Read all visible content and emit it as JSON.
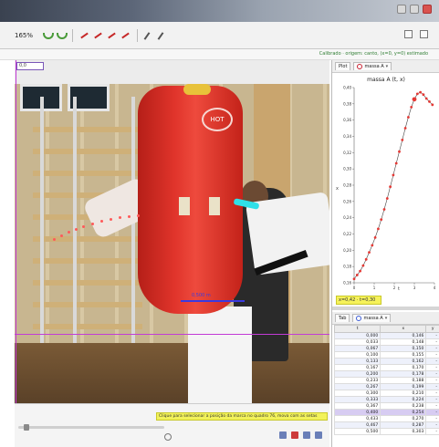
{
  "toolbar": {
    "zoom": "165%",
    "tools": [
      "undo-icon",
      "redo-icon",
      "track-red-icon",
      "track-red-icon",
      "track-red-icon",
      "track-red-icon",
      "pen-icon",
      "pen-icon"
    ]
  },
  "status": {
    "calibration_text": "Calibrado · origem: canto, (x=0, y=0) estimado"
  },
  "video": {
    "frame_field": "0,0",
    "calibration_value": "0,500 m",
    "bag_logo": "HOT",
    "control_hint": "Clique para selecionar a posição da marca no quadro 76, mova com as setas"
  },
  "plot_tab": {
    "plot_label": "Plot",
    "object_label": "massa A"
  },
  "plot": {
    "title": "massa A (t, x)",
    "y_label": "x",
    "x_label": "t",
    "selection_chip": "x=0,42 · t=0,30"
  },
  "table_tab": {
    "table_label": "Tab",
    "object_label": "massa A"
  },
  "table": {
    "headers": [
      "t",
      "x",
      "y"
    ],
    "rows": [
      [
        "0,000",
        "0,146",
        "-"
      ],
      [
        "0,033",
        "0,148",
        "-"
      ],
      [
        "0,067",
        "0,150",
        "-"
      ],
      [
        "0,100",
        "0,155",
        "-"
      ],
      [
        "0,133",
        "0,162",
        "-"
      ],
      [
        "0,167",
        "0,170",
        "-"
      ],
      [
        "0,200",
        "0,178",
        "-"
      ],
      [
        "0,233",
        "0,188",
        "-"
      ],
      [
        "0,267",
        "0,199",
        "-"
      ],
      [
        "0,300",
        "0,210",
        "-"
      ],
      [
        "0,333",
        "0,224",
        "-"
      ],
      [
        "0,367",
        "0,238",
        "-"
      ],
      [
        "0,400",
        "0,254",
        "-"
      ],
      [
        "0,433",
        "0,270",
        "-"
      ],
      [
        "0,467",
        "0,287",
        "-"
      ],
      [
        "0,500",
        "0,303",
        "-"
      ]
    ]
  },
  "chart_data": {
    "type": "scatter",
    "title": "massa A (t, x)",
    "xlabel": "t",
    "ylabel": "x",
    "xlim": [
      0,
      0.8
    ],
    "ylim": [
      0.16,
      0.41
    ],
    "x": [
      0.0,
      0.03,
      0.06,
      0.09,
      0.12,
      0.15,
      0.18,
      0.21,
      0.24,
      0.27,
      0.3,
      0.33,
      0.36,
      0.39,
      0.42,
      0.45,
      0.48,
      0.51,
      0.54,
      0.57,
      0.6,
      0.63,
      0.66,
      0.69,
      0.72,
      0.75,
      0.78
    ],
    "y": [
      0.165,
      0.17,
      0.175,
      0.182,
      0.19,
      0.199,
      0.208,
      0.218,
      0.229,
      0.241,
      0.254,
      0.268,
      0.283,
      0.298,
      0.313,
      0.328,
      0.343,
      0.358,
      0.372,
      0.385,
      0.395,
      0.402,
      0.404,
      0.401,
      0.396,
      0.392,
      0.388
    ],
    "ticks": {
      "y": [
        "0,16",
        "0,18",
        "0,20",
        "0,22",
        "0,24",
        "0,26",
        "0,28",
        "0,30",
        "0,32",
        "0,34",
        "0,36",
        "0,38",
        "0,40"
      ],
      "x": [
        "0",
        "1",
        "2",
        "3",
        "4"
      ]
    },
    "highlight_index": 20,
    "grid": false,
    "legend": "none"
  },
  "colors": {
    "plot_point": "#e53935",
    "plot_line": "#444444",
    "highlight_row": "#d7ccf2",
    "axis_magenta": "#c23bd6",
    "status_green": "#2e7d32"
  }
}
